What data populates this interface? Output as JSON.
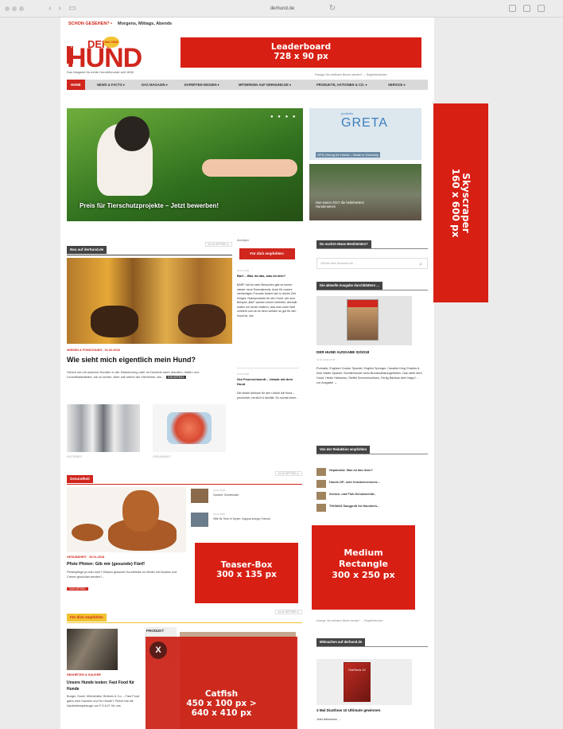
{
  "browser": {
    "url": "derhund.de"
  },
  "topbar": {
    "tag": "SCHON GESEHEN? •",
    "text": "Morgens, Mittags, Abends"
  },
  "logo": {
    "der": "DER",
    "hund": "HUND",
    "seal": "Seit 1932",
    "side": "derhund",
    "tagline": "Das Magazin für echte Hundefreunde seit 1836"
  },
  "header_info": "Frasiga: Wo einfinden Benne werden? → Registrierfunden",
  "nav": {
    "items": [
      {
        "label": "HOME",
        "active": true
      },
      {
        "label": "NEWS & FACTS ▾"
      },
      {
        "label": "DAS MAGAZIN ▾"
      },
      {
        "label": "EXPERTEN-WISSEN ▾"
      },
      {
        "label": "MITWIRKEN AUF DERHUND.DE ▾"
      },
      {
        "label": "PRODUKTE, AKTIONEN & CO. ▾"
      },
      {
        "label": "SERVICE ▾"
      }
    ]
  },
  "hero": {
    "caption": "Preis für Tierschutzprojekte – Jetzt bewerben!",
    "dots": "● ● ● ●"
  },
  "side_promos": {
    "greta_small": "prothelis",
    "greta_brand": "GRETA",
    "greta_caption": "GPS-Ortung für Hunde – Made in Germany",
    "lying_caption": "Das waren 2017 die beliebtesten Hundenamen"
  },
  "section_new": {
    "heading": "Neu auf derhund.de",
    "all_label": "ALLE ARTIKEL ▸",
    "article": {
      "category": "WISSEN & FORSCHUNG · 01.02.2018",
      "title": "Wie sieht mich eigentlich mein Hund?",
      "text": "Gehen wir mit unseren Hunden in der Dämmerung oder im Dunkeln nach draußen, helfen uns Leuchthalsbänder, sie zu sehen. Aber wie sehen die Vierbeiner uns ...",
      "more": "ZUM ARTIKEL"
    },
    "thumb_caption_1": "RATGEBER",
    "thumb_caption_2": "GESUNDHEIT"
  },
  "section_health": {
    "heading": "Gesundheit",
    "all_label": "ALLE ARTIKEL ▸",
    "side_items": [
      {
        "date": "30.01.2018",
        "title": "Vorsicht, Schneesalz!"
      },
      {
        "date": "30.01.2018",
        "title": "Hilfe für Tiere in Syrien: Nuppsa sneiger Tomsut"
      }
    ],
    "article": {
      "category": "GESUNDHEIT · 30.01.2018",
      "title": "Pfote Pfoten: Gib mir (gesunde) Fünf!",
      "text": "Pfotenpflege ja oder nein? Wissen gesunde Hundeflübe im Winter mit Booties und Creme geschützt werden?...",
      "more": "ZUM ARTIKEL"
    }
  },
  "section_recommend": {
    "heading": "Für dich empfohlen",
    "all_label": "ALLE ARTIKEL ▸",
    "produkt_label": "PRODUKT",
    "article": {
      "category": "NEUHEITEN & SAUGRE",
      "title": "Unsere Hunde testen: Fast Food für Hunde",
      "text": "Burger, Sushi, Milchshäke, Brötzen & Co. – Fast Food gab's eine Kalorien und für Hunde? Peech hat die Nacktebeispielsuge von F.S.A.R. für uns"
    }
  },
  "middle_column": {
    "label": "Anzeigen",
    "button": "Für dich empfohlen:",
    "item1": {
      "date": "03.01.2018",
      "title": "Barf – Was ist das, was ist drin?",
      "text": "BARF hat für viele Menschen gibt es immer wieder neue Essenstrends. Auch für unsere vierbeinigen Freunde ändert sich in letzter Zeit einiges. Naturprodukte für den Hund, wie zum Beispiel „Barf“ werden immer beliebter, deshalb wollen wir heute erklären, was man unter Barf versteht und ob es denn wirklich so gut für den Hund ist, wie"
    },
    "item2": {
      "date": "02.01.2018",
      "title": "Gut Feuerschwerdt – Urlaub mit dem Hund",
      "text": "Die ideale Adresse für den Urlaub mit Hund – persönlich, herzlich & familiär. Du suchst einen..."
    }
  },
  "sidebar": {
    "search_heading": "Du suchst etwas Bestimmtes?",
    "search_placeholder": "Gib hier dein Suchwort ein ...",
    "issue_heading": "Die aktuelle Ausgabe durchblättern ...",
    "issue_title": "DER HUND AUSGABE 02/2018",
    "issue_date": "01.01.2018 02:38",
    "issue_text": "Portraits: Englisch Cocker Spaniel, English Springer, Cavalier King Charles & Irish Water Spaniel, Schülerhunde beim Bundesleistungsfühlen, Das steht dem Hund, Heike Harkness, Stoffel Sommerschluss, Fertig Barfaus dem Napp? ... zur Ausgabe →",
    "editor_heading": "Von der Redaktion empfohlen",
    "editor_items": [
      "Hepatomia: Was ist das denn?",
      "Hunde-OP- oder Krankenversiche...",
      "Zecken- und Floh-Schutzschild...",
      "THOMAS Saugprofi für Haustierb..."
    ],
    "info": "Anzeige, Wo einfinden Benne werden? → Registrierfunden",
    "raten_heading": "Mitmachen auf derhund.de",
    "raten_title": "3 Mal DiaShow 10 Ultimate gewinnen",
    "raten_more": "Jetzt teilnehmen →",
    "raten_box": "DiaShow 10"
  },
  "ads": {
    "leaderboard": {
      "name": "Leaderboard",
      "size": "728 x 90 px"
    },
    "skyscraper": {
      "name": "Skyscraper",
      "size": "160 x 600 px"
    },
    "teaser": {
      "name": "Teaser-Box",
      "size": "300 x 135 px"
    },
    "medium": {
      "name": "Medium Rectangle",
      "size": "300 x 250 px"
    },
    "catfish": {
      "name": "Catfish",
      "size": "450 x 100 px >",
      "size2": "640 x 410 px",
      "close": "X"
    }
  }
}
